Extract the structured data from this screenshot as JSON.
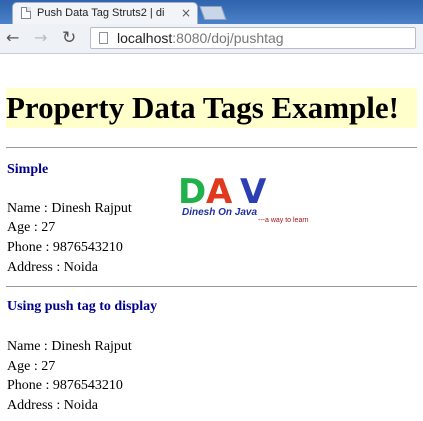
{
  "browser": {
    "tab_title": "Push Data Tag Struts2 | di",
    "tab_close": "×",
    "url_host": "localhost",
    "url_rest": ":8080/doj/pushtag"
  },
  "icons": {
    "back": "arrow-left-icon",
    "forward": "arrow-right-icon",
    "reload": "reload-icon",
    "page": "page-icon",
    "favicon": "document-icon"
  },
  "page": {
    "heading": "Property Data Tags Example!",
    "heading_background": "#ffffcc",
    "section_color": "#00008b",
    "simple": {
      "title": "Simple",
      "name": "Name : Dinesh Rajput",
      "age": "Age : 27",
      "phone": "Phone : 9876543210",
      "address": "Address : Noida"
    },
    "push": {
      "title": "Using push tag to display",
      "name": "Name : Dinesh Rajput",
      "age": "Age : 27",
      "phone": "Phone : 9876543210",
      "address": "Address : Noida"
    },
    "logo": {
      "letter1": "D",
      "letter2": "A",
      "letter3": "V",
      "name": "Dinesh On Java",
      "tagline": "---a way to learn"
    }
  }
}
